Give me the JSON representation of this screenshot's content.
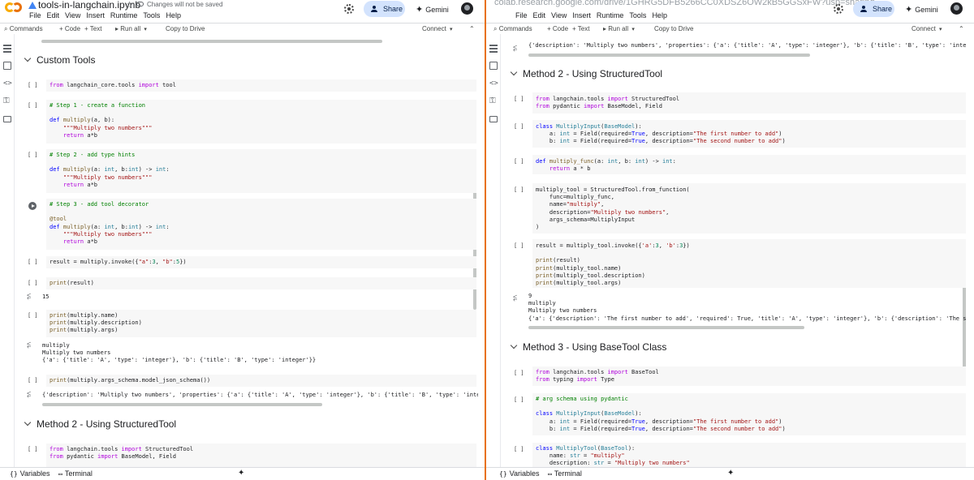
{
  "left": {
    "notebook_title": "tools-in-langchain.ipynb",
    "save_status": "Changes will not be saved",
    "menu": [
      "File",
      "Edit",
      "View",
      "Insert",
      "Runtime",
      "Tools",
      "Help"
    ],
    "share_label": "Share",
    "gemini_label": "Gemini",
    "toolbar": {
      "commands": "Commands",
      "add_code": "+ Code",
      "add_text": "+ Text",
      "run_all": "Run all",
      "copy_to_drive": "Copy to Drive",
      "connect": "Connect"
    },
    "sections": [
      "Custom Tools",
      "Method 2 - Using StructuredTool"
    ],
    "bottom": {
      "variables": "Variables",
      "terminal": "Terminal"
    }
  },
  "right": {
    "url": "colab.research.google.com/drive/1GHRG5DFB5266CC0XDSZ6OW2kB5GGSxFW?usp=sharing",
    "menu": [
      "File",
      "Edit",
      "View",
      "Insert",
      "Runtime",
      "Tools",
      "Help"
    ],
    "share_label": "Share",
    "gemini_label": "Gemini",
    "toolbar": {
      "commands": "Commands",
      "add_code": "+ Code",
      "add_text": "+ Text",
      "run_all": "Run all",
      "copy_to_drive": "Copy to Drive",
      "connect": "Connect"
    },
    "sections": [
      "Method 2 - Using StructuredTool",
      "Method 3 - Using BaseTool Class"
    ],
    "bottom": {
      "variables": "Variables",
      "terminal": "Terminal"
    }
  },
  "cell_bracket": "[ ]",
  "icons": {
    "logo": "colab-logo",
    "drive": "drive-icon",
    "star": "star-icon",
    "settings": "gear-icon",
    "output": "output-icon",
    "run": "play-icon"
  },
  "colors": {
    "divider": "#e8710a",
    "share_bg": "#d3e3fd",
    "code_bg": "#f7f7f7"
  }
}
